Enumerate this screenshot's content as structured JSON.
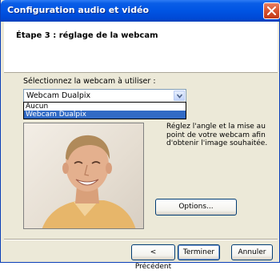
{
  "window": {
    "title": "Configuration audio et vidéo"
  },
  "header": {
    "step_title": "Étape 3 : réglage de la webcam"
  },
  "webcam_select": {
    "label": "Sélectionnez la webcam à utiliser :",
    "selected_value": "Webcam Dualpix",
    "options": [
      "Aucun",
      "Webcam Dualpix"
    ],
    "highlighted_option": "Webcam Dualpix"
  },
  "instructions": {
    "text": "Réglez l'angle et la mise au point de votre webcam afin d'obtenir l'image souhaitée."
  },
  "buttons": {
    "options": "Options...",
    "back": "< Précédent",
    "finish": "Terminer",
    "cancel": "Annuler"
  },
  "icons": {
    "close": "close-icon",
    "dropdown": "chevron-down-icon"
  },
  "colors": {
    "titlebar": "#0054e3",
    "dialog_bg": "#ece9d8",
    "selection": "#316ac5",
    "close_button": "#d7532f"
  }
}
